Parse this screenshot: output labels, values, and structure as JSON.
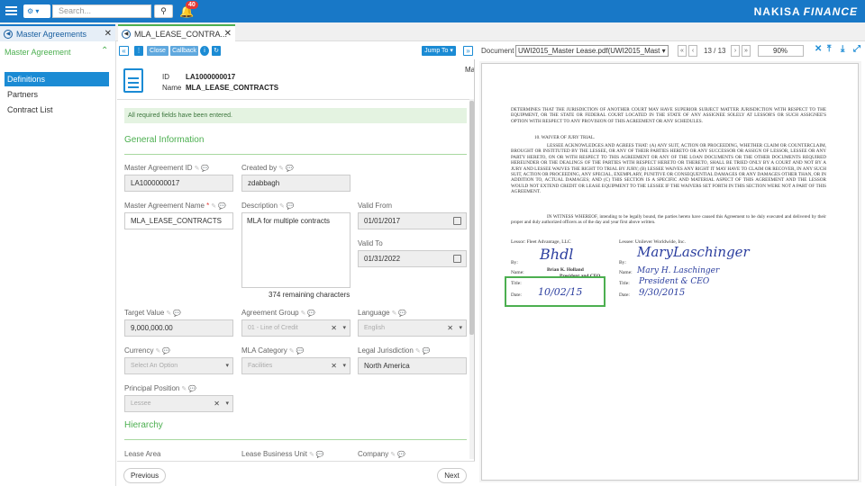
{
  "topbar": {
    "search_placeholder": "Search...",
    "notification_count": "40",
    "brand_main": "NAKISA",
    "brand_sub": "FINANCE"
  },
  "tabs": [
    {
      "label": "Master Agreements"
    },
    {
      "label": "MLA_LEASE_CONTRA..."
    }
  ],
  "leftnav": {
    "header": "Master Agreement",
    "items": [
      "Definitions",
      "Partners",
      "Contract List"
    ]
  },
  "toolbar": {
    "close": "Close",
    "callback": "Callback",
    "jump_to": "Jump To ▾",
    "ma_label": "Ma"
  },
  "header": {
    "id_label": "ID",
    "id_value": "LA1000000017",
    "name_label": "Name",
    "name_value": "MLA_LEASE_CONTRACTS"
  },
  "form": {
    "message": "All required fields have been entered.",
    "general_title": "General Information",
    "master_agreement_id_label": "Master Agreement ID",
    "master_agreement_id": "LA1000000017",
    "created_by_label": "Created by",
    "created_by": "zdabbagh",
    "name_label": "Master Agreement Name",
    "name_value": "MLA_LEASE_CONTRACTS",
    "description_label": "Description",
    "description": "MLA for multiple contracts",
    "remaining": "374 remaining characters",
    "valid_from_label": "Valid From",
    "valid_from": "01/01/2017",
    "valid_to_label": "Valid To",
    "valid_to": "01/31/2022",
    "target_value_label": "Target Value",
    "target_value": "9,000,000.00",
    "agreement_group_label": "Agreement Group",
    "agreement_group": "01 - Line of Credit",
    "language_label": "Language",
    "language": "English",
    "currency_label": "Currency",
    "currency": "Select An Option",
    "mla_category_label": "MLA Category",
    "mla_category": "Facilities",
    "legal_jurisdiction_label": "Legal Jurisdiction",
    "legal_jurisdiction": "North America",
    "principal_position_label": "Principal Position",
    "principal_position": "Lessee",
    "hierarchy_title": "Hierarchy",
    "lease_area_label": "Lease Area",
    "lease_business_unit_label": "Lease Business Unit",
    "company_label": "Company"
  },
  "footer": {
    "previous": "Previous",
    "next": "Next"
  },
  "viewer": {
    "document_label": "Document",
    "document_select": "UWI2015_Master Lease.pdf(UWI2015_Mast ▾",
    "page": "13 / 13",
    "zoom": "90%",
    "para1": "DETERMINES THAT THE JURISDICTION OF ANOTHER COURT MAY HAVE SUPERIOR SUBJECT MATTER JURISDICTION WITH RESPECT TO THE EQUIPMENT, OR THE STATE OR FEDERAL COURT LOCATED IN THE STATE OF ANY ASSIGNEE SOLELY AT LESSOR'S OR SUCH ASSIGNEE'S OPTION WITH RESPECT TO ANY PROVISION OF THIS AGREEMENT OR ANY SCHEDULES.",
    "section": "10.      WAIVER OF JURY TRIAL.",
    "para2": "LESSEE ACKNOWLEDGES AND AGREES THAT: (A) ANY SUIT, ACTION OR PROCEEDING, WHETHER CLAIM OR COUNTERCLAIM, BROUGHT OR INSTITUTED BY THE LESSEE, OR ANY OF THEIR PARTIES HERETO OR ANY SUCCESSOR OR ASSIGN OF LESSOR, LESSEE OR ANY PARTY HERETO, ON OR WITH RESPECT TO THIS AGREEMENT OR ANY OF THE LOAN DOCUMENTS OR THE OTHER DOCUMENTS REQUIRED HEREUNDER OR THE DEALINGS OF THE PARTIES WITH RESPECT HERETO OR THERETO, SHALL BE TRIED ONLY BY A COURT AND NOT BY A JURY AND LESSEE WAIVES THE RIGHT TO TRIAL BY JURY; (B) LESSEE WAIVES ANY RIGHT IT MAY HAVE TO CLAIM OR RECOVER, IN ANY SUCH SUIT, ACTION OR PROCEEDING, ANY SPECIAL, EXEMPLARY, PUNITIVE OR CONSEQUENTIAL DAMAGES OR ANY DAMAGES OTHER THAN, OR IN ADDITION TO, ACTUAL DAMAGES; AND (C) THIS SECTION IS A SPECIFIC AND MATERIAL ASPECT OF THIS AGREEMENT AND THE LESSOR WOULD NOT EXTEND CREDIT OR LEASE EQUIPMENT TO THE LESSEE IF THE WAIVERS SET FORTH IN THIS SECTION WERE NOT A PART OF THIS AGREEMENT.",
    "para3": "IN WITNESS WHEREOF, intending to be legally bound, the parties hereto have caused this Agreement to be duly executed and delivered by their proper and duly authorized officers as of the day and year first above written.",
    "lessor_line": "Lessor:  Fleet Advantage, LLC",
    "lessee_line": "Lessee:  Unilever Worldwide, Inc.",
    "by": "By:",
    "name": "Name:",
    "title": "Title:",
    "date": "Date:",
    "signer1_name": "Brian K. Holland",
    "signer1_title": "President and CFO",
    "signer1_date": "10/02/15",
    "signer2_name": "Mary H. Laschinger",
    "signer2_title": "President & CEO",
    "signer2_date": "9/30/2015"
  }
}
